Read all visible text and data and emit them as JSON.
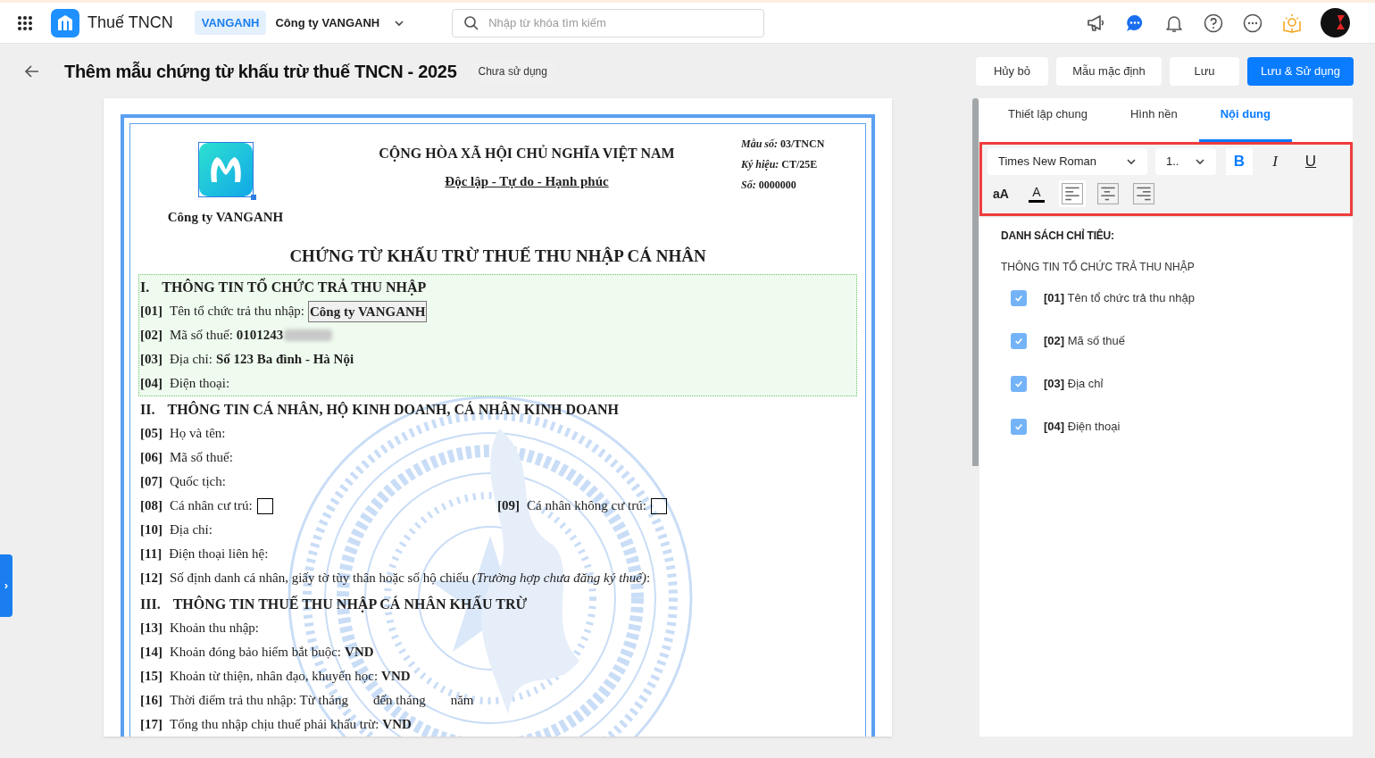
{
  "topbar": {
    "app_name": "Thuế TNCN",
    "company_code": "VANGANH",
    "company_name": "Công ty VANGANH",
    "search": {
      "placeholder": "Nhập từ khóa tìm kiếm"
    }
  },
  "page_header": {
    "title": "Thêm mẫu chứng từ khấu trừ thuế TNCN - 2025",
    "status": "Chưa sử dụng",
    "buttons": [
      {
        "label": "Hủy bỏ",
        "kind": "secondary"
      },
      {
        "label": "Mẫu mặc định",
        "kind": "secondary"
      },
      {
        "label": "Lưu",
        "kind": "secondary"
      },
      {
        "label": "Lưu & Sử dụng",
        "kind": "primary"
      }
    ]
  },
  "side_toggle": "›",
  "document": {
    "company_name": "Công ty VANGANH",
    "national_title": "CỘNG HÒA XÃ HỘI CHỦ NGHĨA VIỆT NAM",
    "motto": "Độc lập - Tự do - Hạnh phúc",
    "meta": [
      {
        "label": "Mẫu số:",
        "value": "03/TNCN"
      },
      {
        "label": "Ký hiệu:",
        "value": "CT/25E"
      },
      {
        "label": "Số:",
        "value": "0000000"
      }
    ],
    "title": "CHỨNG TỪ KHẤU TRỪ THUẾ THU NHẬP CÁ NHÂN",
    "sections": [
      {
        "numeral": "I.",
        "title": "THÔNG TIN TỔ CHỨC TRẢ THU NHẬP",
        "highlighted": true,
        "lines": [
          {
            "kind": "field",
            "code": "[01]",
            "label": "Tên tổ chức trả thu nhập:",
            "value": {
              "text": "Công ty VANGANH",
              "boxed": true
            }
          },
          {
            "kind": "field",
            "code": "[02]",
            "label": "Mã số thuế:",
            "value": {
              "text": "0101243",
              "boxed": false,
              "blurred_tail": true
            }
          },
          {
            "kind": "field",
            "code": "[03]",
            "label": "Địa chỉ:",
            "value": {
              "text": "Số 123 Ba đình - Hà Nội",
              "boxed": false
            }
          },
          {
            "kind": "field",
            "code": "[04]",
            "label": "Điện thoại:"
          }
        ]
      },
      {
        "numeral": "II.",
        "title": "THÔNG TIN CÁ NHÂN, HỘ KINH DOANH, CÁ NHÂN KINH DOANH",
        "highlighted": false,
        "lines": [
          {
            "kind": "field",
            "code": "[05]",
            "label": "Họ và tên:"
          },
          {
            "kind": "field",
            "code": "[06]",
            "label": "Mã số thuế:"
          },
          {
            "kind": "field",
            "code": "[07]",
            "label": "Quốc tịch:"
          },
          {
            "kind": "pair",
            "items": [
              {
                "code": "[08]",
                "label": "Cá nhân cư trú:",
                "checked": false
              },
              {
                "code": "[09]",
                "label": "Cá nhân không cư trú:",
                "checked": false
              }
            ]
          },
          {
            "kind": "field",
            "code": "[10]",
            "label": "Địa chỉ:"
          },
          {
            "kind": "field",
            "code": "[11]",
            "label": "Điện thoại liên hệ:"
          },
          {
            "kind": "field",
            "code": "[12]",
            "label": "Số định danh cá nhân, giấy tờ tùy thân hoặc số hộ chiếu *(Trường hợp chưa đăng ký thuế)*:"
          }
        ]
      },
      {
        "numeral": "III.",
        "title": "THÔNG TIN THUẾ THU NHẬP CÁ NHÂN KHẤU TRỪ",
        "highlighted": false,
        "lines": [
          {
            "kind": "field",
            "code": "[13]",
            "label": "Khoản thu nhập:"
          },
          {
            "kind": "field",
            "code": "[14]",
            "label": "Khoản đóng bảo hiểm bắt buộc:",
            "value": {
              "text": "VND",
              "boxed": false
            }
          },
          {
            "kind": "field",
            "code": "[15]",
            "label": "Khoản từ thiện, nhân đạo, khuyến học:",
            "value": {
              "text": "VND",
              "boxed": false
            }
          },
          {
            "kind": "field",
            "code": "[16]",
            "label": "Thời điểm trả thu nhập: Từ tháng",
            "more": [
              "đến tháng",
              "năm"
            ]
          },
          {
            "kind": "field",
            "code": "[17]",
            "label": "Tổng thu nhập chịu thuế phải khấu trừ:",
            "value": {
              "text": "VND",
              "boxed": false
            }
          }
        ]
      }
    ]
  },
  "panel": {
    "tabs": [
      {
        "label": "Thiết lập chung",
        "selected": false
      },
      {
        "label": "Hình nền",
        "selected": false
      },
      {
        "label": "Nội dung",
        "selected": true
      }
    ],
    "toolbar": {
      "font": "Times New Roman",
      "size": "1..",
      "styles": [
        {
          "label": "B",
          "kind": "bold",
          "selected": true
        },
        {
          "label": "I",
          "kind": "italic",
          "selected": false
        },
        {
          "label": "U",
          "kind": "underline",
          "selected": false
        }
      ],
      "case_toggle": "aA",
      "color_label": "A",
      "alignments": [
        {
          "kind": "left",
          "selected": true
        },
        {
          "kind": "center",
          "selected": false
        },
        {
          "kind": "right",
          "selected": false
        }
      ]
    },
    "list_title": "DANH SÁCH CHỈ TIÊU:",
    "group": "THÔNG TIN TỔ CHỨC TRẢ THU NHẬP",
    "items": [
      {
        "code": "[01]",
        "label": "Tên tổ chức trả thu nhập",
        "checked": true
      },
      {
        "code": "[02]",
        "label": "Mã số thuế",
        "checked": true
      },
      {
        "code": "[03]",
        "label": "Địa chỉ",
        "checked": true
      },
      {
        "code": "[04]",
        "label": "Điện thoại",
        "checked": true
      }
    ]
  }
}
